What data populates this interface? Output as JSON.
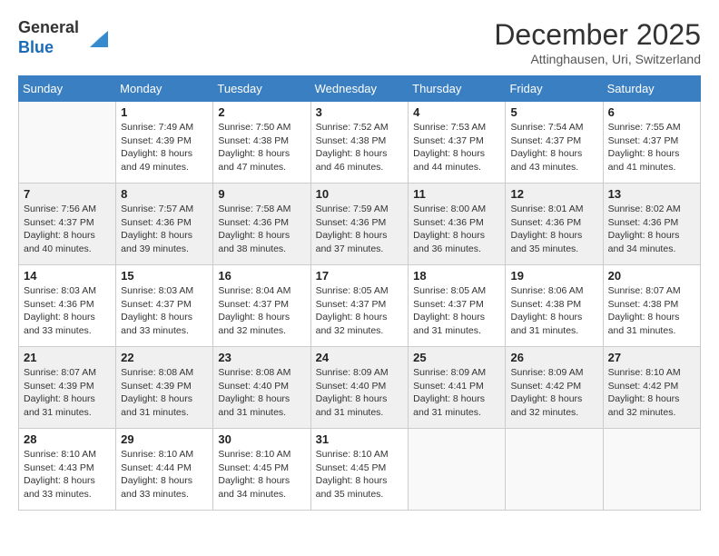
{
  "header": {
    "logo_line1": "General",
    "logo_line2": "Blue",
    "month_title": "December 2025",
    "subtitle": "Attinghausen, Uri, Switzerland"
  },
  "days_of_week": [
    "Sunday",
    "Monday",
    "Tuesday",
    "Wednesday",
    "Thursday",
    "Friday",
    "Saturday"
  ],
  "weeks": [
    [
      {
        "day": "",
        "info": ""
      },
      {
        "day": "1",
        "info": "Sunrise: 7:49 AM\nSunset: 4:39 PM\nDaylight: 8 hours\nand 49 minutes."
      },
      {
        "day": "2",
        "info": "Sunrise: 7:50 AM\nSunset: 4:38 PM\nDaylight: 8 hours\nand 47 minutes."
      },
      {
        "day": "3",
        "info": "Sunrise: 7:52 AM\nSunset: 4:38 PM\nDaylight: 8 hours\nand 46 minutes."
      },
      {
        "day": "4",
        "info": "Sunrise: 7:53 AM\nSunset: 4:37 PM\nDaylight: 8 hours\nand 44 minutes."
      },
      {
        "day": "5",
        "info": "Sunrise: 7:54 AM\nSunset: 4:37 PM\nDaylight: 8 hours\nand 43 minutes."
      },
      {
        "day": "6",
        "info": "Sunrise: 7:55 AM\nSunset: 4:37 PM\nDaylight: 8 hours\nand 41 minutes."
      }
    ],
    [
      {
        "day": "7",
        "info": "Sunrise: 7:56 AM\nSunset: 4:37 PM\nDaylight: 8 hours\nand 40 minutes."
      },
      {
        "day": "8",
        "info": "Sunrise: 7:57 AM\nSunset: 4:36 PM\nDaylight: 8 hours\nand 39 minutes."
      },
      {
        "day": "9",
        "info": "Sunrise: 7:58 AM\nSunset: 4:36 PM\nDaylight: 8 hours\nand 38 minutes."
      },
      {
        "day": "10",
        "info": "Sunrise: 7:59 AM\nSunset: 4:36 PM\nDaylight: 8 hours\nand 37 minutes."
      },
      {
        "day": "11",
        "info": "Sunrise: 8:00 AM\nSunset: 4:36 PM\nDaylight: 8 hours\nand 36 minutes."
      },
      {
        "day": "12",
        "info": "Sunrise: 8:01 AM\nSunset: 4:36 PM\nDaylight: 8 hours\nand 35 minutes."
      },
      {
        "day": "13",
        "info": "Sunrise: 8:02 AM\nSunset: 4:36 PM\nDaylight: 8 hours\nand 34 minutes."
      }
    ],
    [
      {
        "day": "14",
        "info": "Sunrise: 8:03 AM\nSunset: 4:36 PM\nDaylight: 8 hours\nand 33 minutes."
      },
      {
        "day": "15",
        "info": "Sunrise: 8:03 AM\nSunset: 4:37 PM\nDaylight: 8 hours\nand 33 minutes."
      },
      {
        "day": "16",
        "info": "Sunrise: 8:04 AM\nSunset: 4:37 PM\nDaylight: 8 hours\nand 32 minutes."
      },
      {
        "day": "17",
        "info": "Sunrise: 8:05 AM\nSunset: 4:37 PM\nDaylight: 8 hours\nand 32 minutes."
      },
      {
        "day": "18",
        "info": "Sunrise: 8:05 AM\nSunset: 4:37 PM\nDaylight: 8 hours\nand 31 minutes."
      },
      {
        "day": "19",
        "info": "Sunrise: 8:06 AM\nSunset: 4:38 PM\nDaylight: 8 hours\nand 31 minutes."
      },
      {
        "day": "20",
        "info": "Sunrise: 8:07 AM\nSunset: 4:38 PM\nDaylight: 8 hours\nand 31 minutes."
      }
    ],
    [
      {
        "day": "21",
        "info": "Sunrise: 8:07 AM\nSunset: 4:39 PM\nDaylight: 8 hours\nand 31 minutes."
      },
      {
        "day": "22",
        "info": "Sunrise: 8:08 AM\nSunset: 4:39 PM\nDaylight: 8 hours\nand 31 minutes."
      },
      {
        "day": "23",
        "info": "Sunrise: 8:08 AM\nSunset: 4:40 PM\nDaylight: 8 hours\nand 31 minutes."
      },
      {
        "day": "24",
        "info": "Sunrise: 8:09 AM\nSunset: 4:40 PM\nDaylight: 8 hours\nand 31 minutes."
      },
      {
        "day": "25",
        "info": "Sunrise: 8:09 AM\nSunset: 4:41 PM\nDaylight: 8 hours\nand 31 minutes."
      },
      {
        "day": "26",
        "info": "Sunrise: 8:09 AM\nSunset: 4:42 PM\nDaylight: 8 hours\nand 32 minutes."
      },
      {
        "day": "27",
        "info": "Sunrise: 8:10 AM\nSunset: 4:42 PM\nDaylight: 8 hours\nand 32 minutes."
      }
    ],
    [
      {
        "day": "28",
        "info": "Sunrise: 8:10 AM\nSunset: 4:43 PM\nDaylight: 8 hours\nand 33 minutes."
      },
      {
        "day": "29",
        "info": "Sunrise: 8:10 AM\nSunset: 4:44 PM\nDaylight: 8 hours\nand 33 minutes."
      },
      {
        "day": "30",
        "info": "Sunrise: 8:10 AM\nSunset: 4:45 PM\nDaylight: 8 hours\nand 34 minutes."
      },
      {
        "day": "31",
        "info": "Sunrise: 8:10 AM\nSunset: 4:45 PM\nDaylight: 8 hours\nand 35 minutes."
      },
      {
        "day": "",
        "info": ""
      },
      {
        "day": "",
        "info": ""
      },
      {
        "day": "",
        "info": ""
      }
    ]
  ]
}
